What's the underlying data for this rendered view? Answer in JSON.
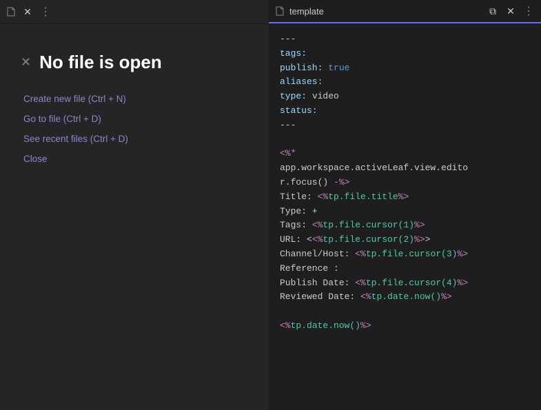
{
  "tabBar": {
    "leftTab": {
      "icon": "📄",
      "closeLabel": "✕",
      "moreLabel": "⋮"
    },
    "rightTab": {
      "icon": "📄",
      "title": "template",
      "splitLabel": "⧉",
      "closeLabel": "✕",
      "moreLabel": "⋮"
    }
  },
  "leftPanel": {
    "title": "No file is open",
    "closeIcon": "✕",
    "actions": [
      "Create new file (Ctrl + N)",
      "Go to file (Ctrl + D)",
      "See recent files (Ctrl + D)",
      "Close"
    ]
  },
  "rightPanel": {
    "lines": [
      {
        "text": "---",
        "type": "dash"
      },
      {
        "text": "tags:",
        "type": "key"
      },
      {
        "text": "publish: true",
        "type": "publish"
      },
      {
        "text": "aliases:",
        "type": "key"
      },
      {
        "text": "type: video",
        "type": "type"
      },
      {
        "text": "status:",
        "type": "key"
      },
      {
        "text": "---",
        "type": "dash"
      },
      {
        "text": "",
        "type": "empty"
      },
      {
        "text": "<%*",
        "type": "template-tag"
      },
      {
        "text": "app.workspace.activeLeaf.view.editor.focus() -%>",
        "type": "template-body"
      },
      {
        "text": "Title: <%tp.file.title%>",
        "type": "template-line"
      },
      {
        "text": "Type: +",
        "type": "label-line"
      },
      {
        "text": "Tags: <%tp.file.cursor(1)%>",
        "type": "template-line"
      },
      {
        "text": "URL: <<%tp.file.cursor(2)%>>",
        "type": "template-url"
      },
      {
        "text": "Channel/Host: <%tp.file.cursor(3)%>",
        "type": "template-line"
      },
      {
        "text": "Reference :",
        "type": "label-line"
      },
      {
        "text": "Publish Date: <%tp.file.cursor(4)%>",
        "type": "template-line"
      },
      {
        "text": "Reviewed Date: <%tp.date.now()%>",
        "type": "template-line"
      },
      {
        "text": "",
        "type": "empty"
      },
      {
        "text": "<%tp.date.now()%>",
        "type": "template-standalone"
      }
    ]
  }
}
